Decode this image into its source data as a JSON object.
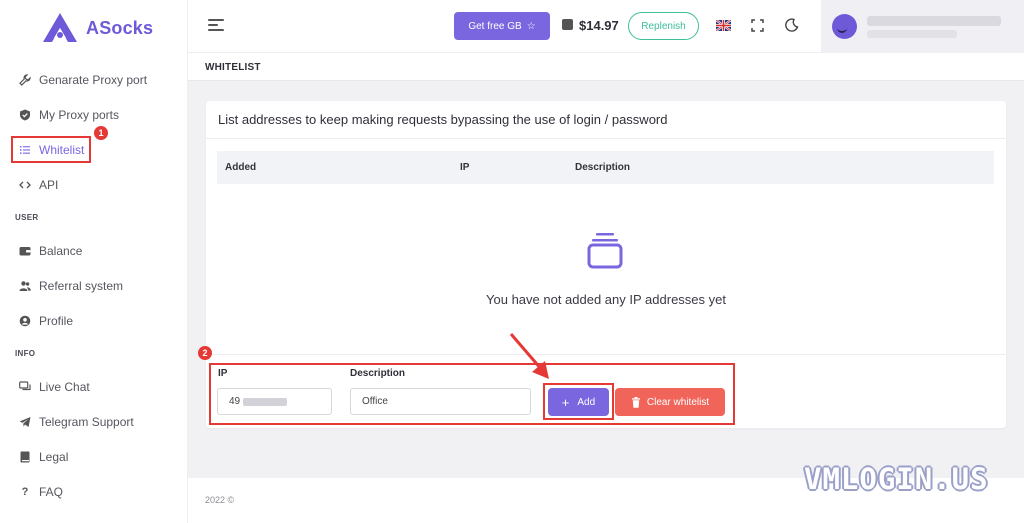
{
  "app": {
    "name": "ASocks",
    "brand_color": "#6e5ad8"
  },
  "sidebar": {
    "items": [
      {
        "label": "Genarate Proxy port",
        "icon": "wrench-icon"
      },
      {
        "label": "My Proxy ports",
        "icon": "shield-icon"
      },
      {
        "label": "Whitelist",
        "icon": "list-icon",
        "active": true
      },
      {
        "label": "API",
        "icon": "code-icon"
      }
    ],
    "user_section": "USER",
    "user_items": [
      {
        "label": "Balance",
        "icon": "wallet-icon"
      },
      {
        "label": "Referral system",
        "icon": "users-icon"
      },
      {
        "label": "Profile",
        "icon": "user-icon"
      }
    ],
    "info_section": "INFO",
    "info_items": [
      {
        "label": "Live Chat",
        "icon": "chat-icon"
      },
      {
        "label": "Telegram Support",
        "icon": "telegram-icon"
      },
      {
        "label": "Legal",
        "icon": "book-icon"
      },
      {
        "label": "FAQ",
        "icon": "question-icon"
      }
    ]
  },
  "header": {
    "get_free_label": "Get free GB",
    "balance": "$14.97",
    "replenish_label": "Replenish"
  },
  "page": {
    "title": "WHITELIST",
    "card_heading": "List addresses to keep making requests bypassing the use of login / password",
    "columns": [
      "Added",
      "IP",
      "Description"
    ],
    "empty_message": "You have not added any IP addresses yet",
    "form": {
      "ip_label": "IP",
      "ip_value": "49",
      "description_label": "Description",
      "description_value": "Office",
      "add_label": "Add",
      "clear_label": "Clear whitelist"
    }
  },
  "annotations": {
    "step1": "1",
    "step2": "2",
    "color": "#e53935"
  },
  "footer": {
    "copyright": "2022 ©"
  },
  "watermark": "VMLOGIN.US"
}
